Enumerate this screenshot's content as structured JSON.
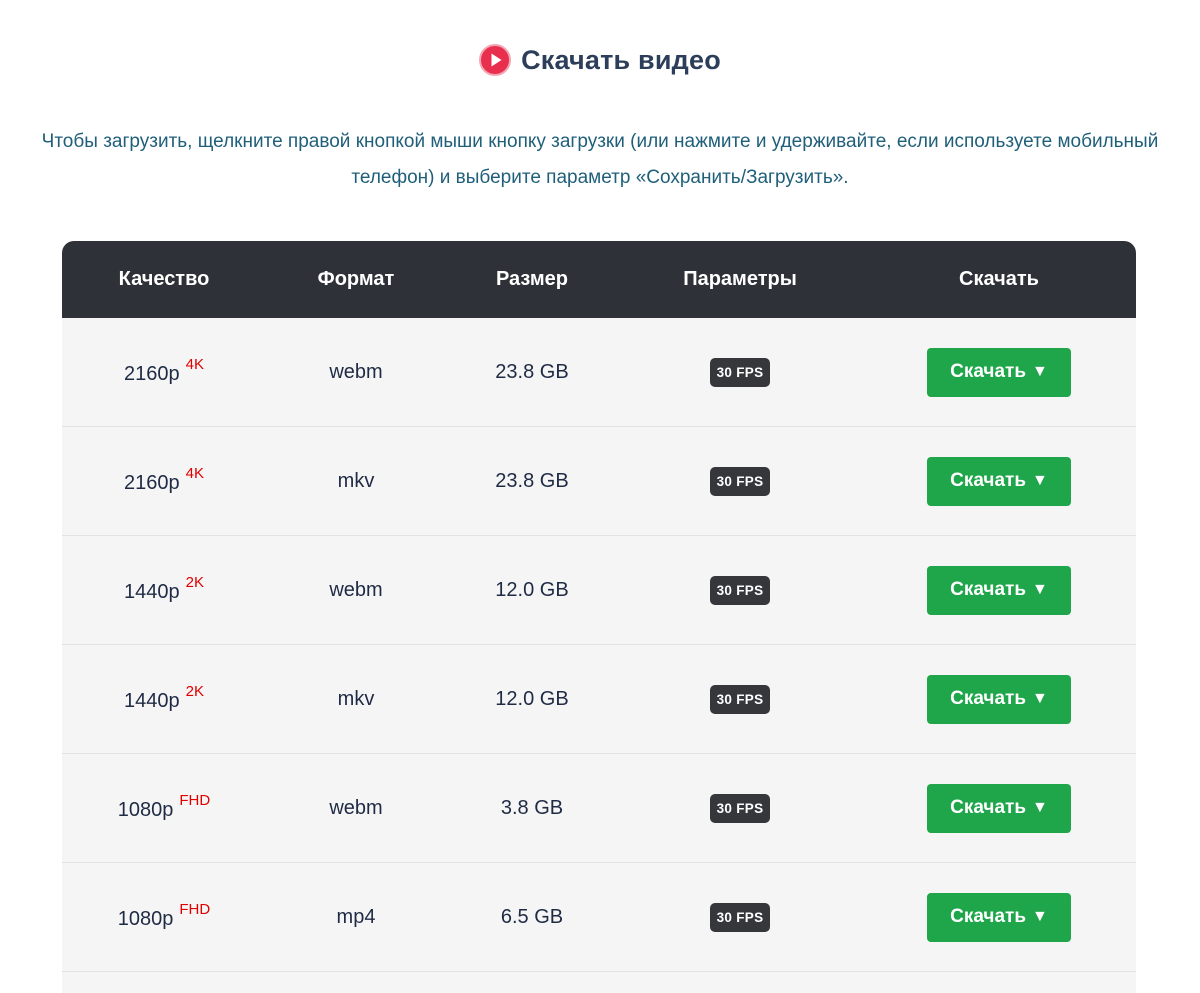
{
  "header": {
    "icon": "play-circle-icon",
    "title": "Скачать видео",
    "accent": "#e8304e"
  },
  "instructions": "Чтобы загрузить, щелкните правой кнопкой мыши кнопку загрузки (или нажмите и удерживайте, если используете мобильный телефон) и выберите параметр «Сохранить/Загрузить».",
  "table": {
    "columns": [
      "Качество",
      "Формат",
      "Размер",
      "Параметры",
      "Скачать"
    ],
    "rows": [
      {
        "quality": "2160p",
        "badge": "4K",
        "format": "webm",
        "size": "23.8 GB",
        "params": "30 FPS",
        "button": "Скачать",
        "arrow": "▼"
      },
      {
        "quality": "2160p",
        "badge": "4K",
        "format": "mkv",
        "size": "23.8 GB",
        "params": "30 FPS",
        "button": "Скачать",
        "arrow": "▼"
      },
      {
        "quality": "1440p",
        "badge": "2K",
        "format": "webm",
        "size": "12.0 GB",
        "params": "30 FPS",
        "button": "Скачать",
        "arrow": "▼"
      },
      {
        "quality": "1440p",
        "badge": "2K",
        "format": "mkv",
        "size": "12.0 GB",
        "params": "30 FPS",
        "button": "Скачать",
        "arrow": "▼"
      },
      {
        "quality": "1080p",
        "badge": "FHD",
        "format": "webm",
        "size": "3.8 GB",
        "params": "30 FPS",
        "button": "Скачать",
        "arrow": "▼"
      },
      {
        "quality": "1080p",
        "badge": "FHD",
        "format": "mp4",
        "size": "6.5 GB",
        "params": "30 FPS",
        "button": "Скачать",
        "arrow": "▼"
      }
    ]
  },
  "colors": {
    "header_bg": "#2e3138",
    "row_bg": "#f5f5f5",
    "button_bg": "#1fa54a",
    "badge_red": "#e00000",
    "fps_bg": "#35373b",
    "text_link": "#1f5f7a"
  }
}
